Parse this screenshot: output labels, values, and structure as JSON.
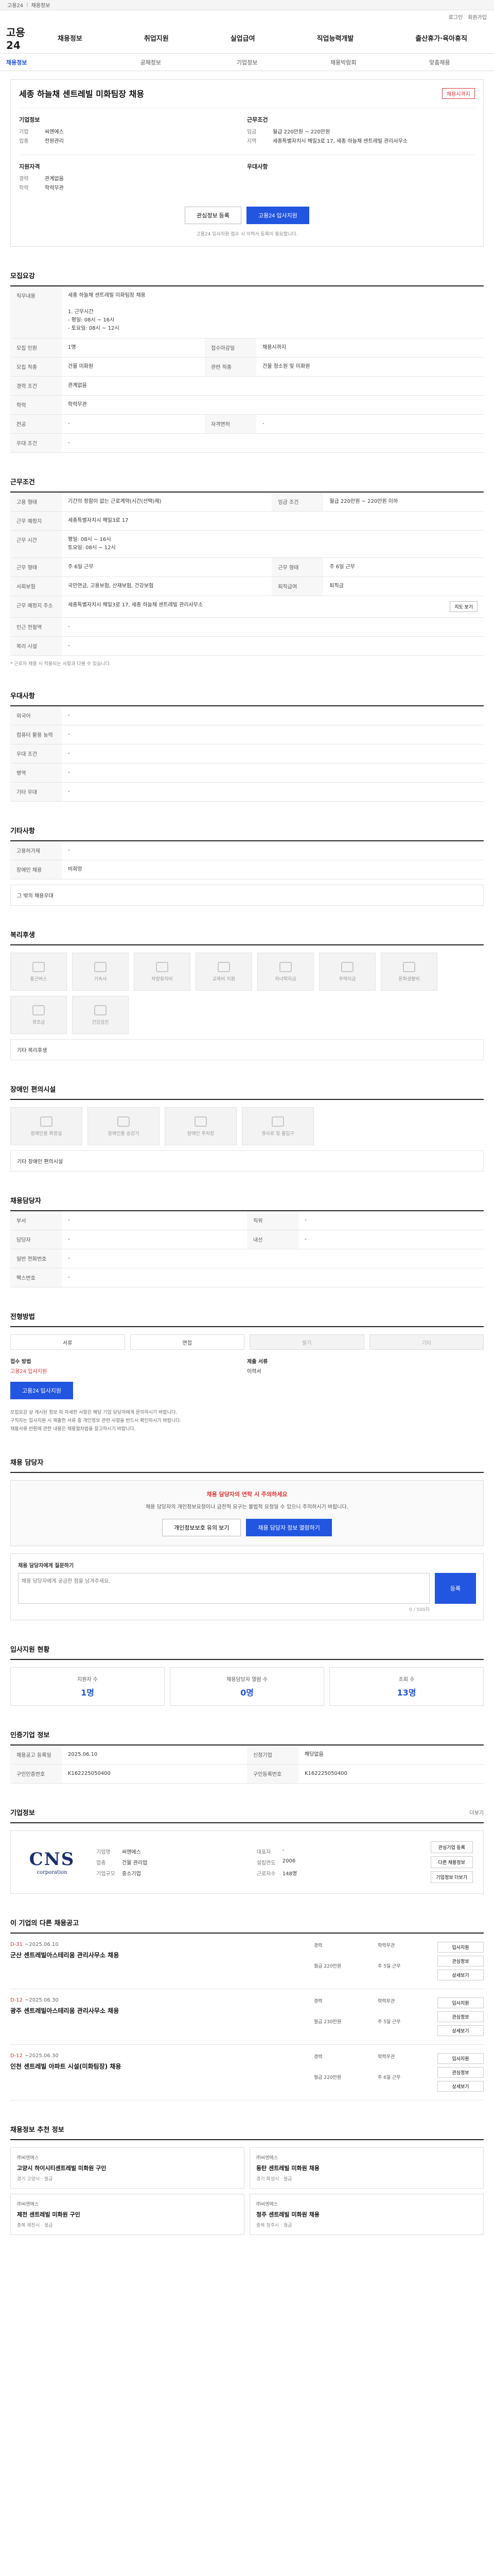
{
  "topbar": {
    "home": "고용24",
    "sep": "|",
    "links": [
      "채용정보"
    ]
  },
  "utilbar": {
    "links": [
      "로그인",
      "회원가입"
    ]
  },
  "gnb": {
    "logo": "고용24",
    "menu": [
      "채용정보",
      "취업지원",
      "실업급여",
      "직업능력개발",
      "출산휴가·육아휴직"
    ]
  },
  "lnb": {
    "current": "채용정보",
    "items": [
      "채용정보",
      "공채정보",
      "기업정보",
      "채용박람회",
      "맞춤채용"
    ]
  },
  "head": {
    "title": "세종 하늘채 센트레빌 미화팀장 채용",
    "badge": "채용시까지",
    "company_h": "기업정보",
    "company_rows": [
      {
        "k": "기업",
        "v": "씨엔에스"
      },
      {
        "k": "업종",
        "v": "전원관리"
      }
    ],
    "cond_h": "근무조건",
    "cond_rows": [
      {
        "k": "임금",
        "v": "월급 220만원 ~ 220만원"
      },
      {
        "k": "지역",
        "v": "세종특별자치시 해밀3로 17, 세종 하늘채 센트레빌 관리사무소"
      }
    ],
    "appl_h": "지원자격",
    "appl_rows": [
      {
        "k": "경력",
        "v": "관계없음"
      },
      {
        "k": "학력",
        "v": "학력무관"
      }
    ],
    "pref_h": "우대사항",
    "btn_scrap": "관심정보 등록",
    "btn_apply": "고용24 입사지원",
    "note": "고용24 입사지원 접수 시 이력서 등록이 필요합니다."
  },
  "recruit": {
    "title": "모집요강",
    "job_h": "직무내용",
    "job_text": "세종 하늘채 센트레빌 미화팀장 채용\n\n1. 근무시간\n - 평일: 08시 ~ 16시\n - 토요일: 08시 ~ 12시",
    "rows": [
      {
        "k": "모집 인원",
        "v": "1명",
        "k2": "접수마감일",
        "v2": "채용시까지"
      },
      {
        "k": "모집 직종",
        "v": "건물 미화원",
        "k2": "관련 직종",
        "v2": "건물 청소원 및 미화원"
      },
      {
        "k": "경력 조건",
        "v": "관계없음",
        "k2": "",
        "v2": ""
      },
      {
        "k": "학력",
        "v": "학력무관",
        "k2": "",
        "v2": ""
      },
      {
        "k": "전공",
        "v": "-",
        "k2": "자격면허",
        "v2": "-"
      },
      {
        "k": "우대 조건",
        "v": "-",
        "k2": "",
        "v2": ""
      }
    ]
  },
  "work": {
    "title": "근무조건",
    "rows": [
      {
        "k": "고용 형태",
        "v": "기간의 정함이 없는 근로계약(시간(선택)제)",
        "k2": "임금 조건",
        "v2": "월급 220만원 ~ 220만원 이하"
      },
      {
        "k": "근무 예정지",
        "v": "세종특별자치시 해밀3로 17",
        "k2": "",
        "v2": ""
      },
      {
        "k": "근무 시간",
        "v": "평일: 08시 ~ 16시\n토요일: 08시 ~ 12시",
        "k2": "",
        "v2": ""
      },
      {
        "k": "근무 형태",
        "v": "주 6일 근무",
        "k2": "근무 형태",
        "v2": "주 6일 근무"
      },
      {
        "k": "사회보험",
        "v": "국민연금, 고용보험, 산재보험, 건강보험",
        "k2": "퇴직급여",
        "v2": "퇴직금"
      },
      {
        "k": "근무 예정지 주소",
        "v": "세종특별자치시 해밀3로 17, 세종 하늘채 센트레빌 관리사무소",
        "k2": "",
        "v2": ""
      },
      {
        "k": "인근 전철역",
        "v": "-",
        "k2": "",
        "v2": ""
      },
      {
        "k": "복리 시설",
        "v": "-",
        "k2": "",
        "v2": ""
      }
    ],
    "map_btn": "지도 보기",
    "note": "* 근로자 채용 시 적용되는 사항과 다를 수 있습니다."
  },
  "pref": {
    "title": "우대사항",
    "rows": [
      {
        "k": "외국어",
        "v": "-"
      },
      {
        "k": "컴퓨터 활용 능력",
        "v": "-"
      },
      {
        "k": "우대 조건",
        "v": "-"
      },
      {
        "k": "병역",
        "v": "-"
      },
      {
        "k": "기타 우대",
        "v": "-"
      }
    ]
  },
  "etc": {
    "title": "기타사항",
    "rows": [
      {
        "k": "고용허가제",
        "v": "-"
      },
      {
        "k": "장애인 채용",
        "v": "비희망"
      }
    ],
    "text": "그 밖의 채용우대"
  },
  "welfare": {
    "title": "복리후생",
    "items": [
      "통근버스",
      "기숙사",
      "차량유지비",
      "교육비 지원",
      "자녀학자금",
      "주택자금",
      "문화생활비",
      "경조금",
      "건강검진"
    ],
    "text": "기타 복리후생"
  },
  "disabled": {
    "title": "장애인 편의시설",
    "items": [
      "장애인용 화장실",
      "장애인용 승강기",
      "장애인 주차장",
      "경사로 및 출입구"
    ],
    "text": "기타 장애인 편의시설"
  },
  "contact": {
    "title": "채용담당자",
    "rows": [
      {
        "k": "부서",
        "v": "-",
        "k2": "직위",
        "v2": "-"
      },
      {
        "k": "담당자",
        "v": "-",
        "k2": "내선",
        "v2": "-"
      },
      {
        "k": "일반 전화번호",
        "v": "-",
        "k2": "",
        "v2": ""
      },
      {
        "k": "팩스번호",
        "v": "-",
        "k2": "",
        "v2": ""
      }
    ]
  },
  "process": {
    "title": "전형방법",
    "steps": [
      "서류",
      "면접",
      "필기",
      "기타"
    ],
    "apply_h": "접수 방법",
    "apply_v": "고용24 입사지원",
    "docs_h": "제출 서류",
    "docs_v": "이력서",
    "btn": "고용24 입사지원",
    "bullets": [
      "모집요강 상 게시된 정보 외 자세한 사항은 해당 기업 담당자에게 문의하시기 바랍니다.",
      "구직자는 입사지원 시 제출한 서류 중 개인정보 관련 사항을 반드시 확인하시기 바랍니다.",
      "채용서류 반환에 관한 내용은 채용절차법을 참고하시기 바랍니다."
    ]
  },
  "qa": {
    "title": "채용 담당자",
    "alert_t": "채용 담당자의 연락 시 주의하세요",
    "alert_d": "채용 담당자의 개인정보요청이나 금전적 요구는 불법적 요청일 수 있으니 주의하시기 바랍니다.",
    "btn1": "개인정보보호 유의 보기",
    "btn2": "채용 담당자 정보 열람하기",
    "q_label": "채용 담당자에게 질문하기",
    "q_placeholder": "채용 담당자에게 궁금한 점을 남겨주세요.",
    "q_btn": "등록",
    "q_count": "0 / 500자"
  },
  "stats": {
    "title": "입사지원 현황",
    "items": [
      {
        "l": "지원자 수",
        "n": "1명"
      },
      {
        "l": "채용담당자 열람 수",
        "n": "0명"
      },
      {
        "l": "조회 수",
        "n": "13명"
      }
    ]
  },
  "info": {
    "title": "인증기업 정보",
    "rows": [
      {
        "k": "채용공고 등록일",
        "v": "2025.06.10",
        "k2": "신청기업",
        "v2": "해당없음"
      },
      {
        "k": "구인인증번호",
        "v": "K162225050400",
        "k2": "구인등록번호",
        "v2": "K162225050400"
      }
    ]
  },
  "company": {
    "title": "기업정보",
    "more": "더보기",
    "logo_mark": "CNS",
    "logo_sub": "corporation",
    "rows": [
      {
        "k": "기업명",
        "v": "씨엔에스",
        "k2": "대표자",
        "v2": "-"
      },
      {
        "k": "업종",
        "v": "건물 관리업",
        "k2": "설립연도",
        "v2": "2006"
      },
      {
        "k": "기업규모",
        "v": "중소기업",
        "k2": "근로자수",
        "v2": "148명"
      }
    ],
    "btns": [
      "관심기업 등록",
      "다른 채용정보",
      "기업정보 더보기"
    ]
  },
  "others": {
    "title": "이 기업의 다른 채용공고",
    "items": [
      {
        "dday": "D-31",
        "date": "~2025.06.10",
        "title": "군산 센트레빌아스테리움 관리사무소 채용",
        "tags": [
          "경력",
          "학력무관",
          "월급 220만원",
          "주 5일 근무"
        ]
      },
      {
        "dday": "D-12",
        "date": "~2025.06.30",
        "title": "광주 센트레빌아스테리움 관리사무소 채용",
        "tags": [
          "경력",
          "학력무관",
          "월급 230만원",
          "주 5일 근무"
        ]
      },
      {
        "dday": "D-12",
        "date": "~2025.06.30",
        "title": "인천 센트레빌 아파트 시설(미화팀장) 채용",
        "tags": [
          "경력",
          "학력무관",
          "월급 220만원",
          "주 6일 근무"
        ]
      }
    ],
    "btns": [
      "입사지원",
      "관심정보",
      "상세보기"
    ]
  },
  "ads": {
    "title": "채용정보 추천 정보",
    "cards": [
      {
        "co": "㈜씨엔에스",
        "t": "고양시 하이시티센트레빌 미화원 구인",
        "meta": "경기 고양시 · 월급"
      },
      {
        "co": "㈜씨엔에스",
        "t": "동탄 센트레빌 미화원 채용",
        "meta": "경기 화성시 · 월급"
      },
      {
        "co": "㈜씨엔에스",
        "t": "제천 센트레빌 미화원 구인",
        "meta": "충북 제천시 · 월급"
      },
      {
        "co": "㈜씨엔에스",
        "t": "청주 센트레빌 미화원 채용",
        "meta": "충북 청주시 · 월급"
      }
    ]
  }
}
